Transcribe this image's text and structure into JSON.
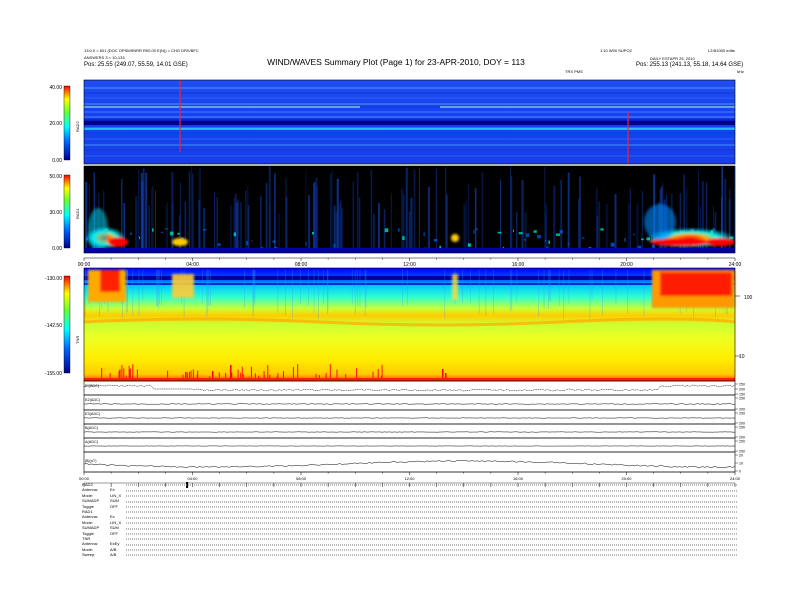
{
  "header": {
    "title": "WIND/WAVES Summary Plot (Page 1) for 23-APR-2010, DOY = 113",
    "left_lines": [
      "13:0.0 = 601 (DOC OPSMSNRR Rf/0.00 E(N)) = CHG DRS/BFC",
      "ANSWERS 3 = 10-133"
    ],
    "left_pos": "Pos:    25.55 (249.07, 55.59, 14.01 GSE)",
    "right_top_1": "1.10 W00 SUPO2",
    "right_top_2": "L2:B1000 edits",
    "right_date": "DAILY ESTAPR 25, 2010",
    "right_pos": "Pos:    255.13 (241.13, 55.18, 14.64 GSE)",
    "right_small": "TRX PMS",
    "right_unit": "kHz"
  },
  "colors": {
    "rad_low": "#00008b",
    "rad_mid": "#00ffff",
    "rad_high": "#ffff00",
    "rad_max": "#ff0000",
    "background_dark": "#000000"
  },
  "chart_data": [
    {
      "type": "heatmap",
      "name": "RAD2",
      "ylabel": "RAD2",
      "yticks": [
        "40.00",
        "20.00",
        "0.00"
      ],
      "ylim": [
        0,
        40
      ],
      "xlim": [
        0,
        24
      ],
      "notes": "Uniform blue spectrogram with horizontal lines, red vertical spikes near 03:48 and 20:00"
    },
    {
      "type": "heatmap",
      "name": "RAD1",
      "ylabel": "RAD1",
      "yticks": [
        "50.00",
        "30.00",
        "0.00"
      ],
      "ylim": [
        0,
        50
      ],
      "xlim": [
        0,
        24
      ],
      "xticks": [
        "00:00",
        "04:00",
        "08:00",
        "12:00",
        "16:00",
        "20:00",
        "24:00"
      ],
      "notes": "Dark background, intensity bursts near 00:30-03:00 and 21:30-24:00"
    },
    {
      "type": "heatmap",
      "name": "TNR",
      "ylabel": "TNR",
      "yticks": [
        "-130.00",
        "-142.50",
        "-155.00"
      ],
      "ylim": [
        -155,
        -130
      ],
      "xlim": [
        0,
        24
      ],
      "right_ticks": [
        "100",
        "10"
      ],
      "notes": "Banded spectrum: red/yellow top bursts, cyan-green middle, yellow lower, red spikes bottom"
    },
    {
      "type": "line",
      "name": "EI(ADC)",
      "ylabel": "EI(ADC)",
      "right_ticks": [
        "250",
        "200",
        "150"
      ],
      "xlim": [
        0,
        24
      ]
    },
    {
      "type": "line",
      "name": "E2(ADC)",
      "ylabel": "E2(ADC)",
      "right_ticks": [
        "250",
        "200"
      ],
      "xlim": [
        0,
        24
      ]
    },
    {
      "type": "line",
      "name": "E3(ADC)",
      "ylabel": "E3(ADC)",
      "right_ticks": [
        "250",
        "200"
      ],
      "xlim": [
        0,
        24
      ]
    },
    {
      "type": "line",
      "name": "B(ADC)",
      "ylabel": "B(ADC)",
      "right_ticks": [
        "250",
        "200"
      ],
      "xlim": [
        0,
        24
      ]
    },
    {
      "type": "line",
      "name": "A(ADC)",
      "ylabel": "A(ADC)",
      "right_ticks": [
        "250",
        "200"
      ],
      "xlim": [
        0,
        24
      ]
    },
    {
      "type": "line",
      "name": "|B|(nT)",
      "ylabel": "|B|(nT)",
      "right_ticks": [
        "20",
        "10",
        "0"
      ],
      "xlim": [
        0,
        24
      ],
      "xticks": [
        "00:00",
        "04:00",
        "08:00",
        "12:00",
        "16:00",
        "20:00",
        "24:00"
      ]
    }
  ],
  "footer": {
    "groups": [
      {
        "rows": [
          {
            "name": "RAD2",
            "val": ""
          },
          {
            "name": "Antenna:",
            "val": "Ex"
          },
          {
            "name": "Mode:",
            "val": "LIN_X"
          },
          {
            "name": "SUMADP",
            "val": "SUM"
          },
          {
            "name": "Toggle",
            "val": "OFF"
          }
        ]
      },
      {
        "rows": [
          {
            "name": "RAD1",
            "val": ""
          },
          {
            "name": "Antenna:",
            "val": "Ex"
          },
          {
            "name": "Mode:",
            "val": "LIN_X"
          },
          {
            "name": "SUMADP",
            "val": "SUM"
          },
          {
            "name": "Toggle",
            "val": "OFF"
          }
        ]
      },
      {
        "rows": [
          {
            "name": "TNR",
            "val": ""
          },
          {
            "name": "Antenna:",
            "val": "ExEy"
          },
          {
            "name": "Mode:",
            "val": "A/B"
          },
          {
            "name": "Sweep:",
            "val": "A/B"
          }
        ]
      }
    ]
  }
}
